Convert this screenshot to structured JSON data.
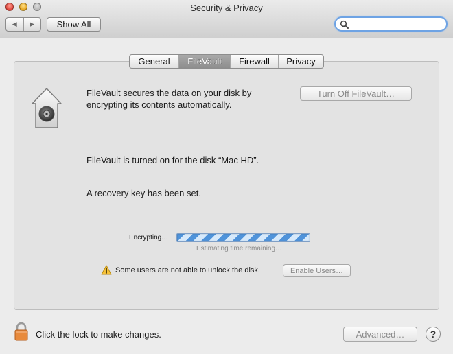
{
  "window": {
    "title": "Security & Privacy"
  },
  "toolbar": {
    "back_icon": "back-triangle-icon",
    "forward_icon": "forward-triangle-icon",
    "show_all_label": "Show All",
    "search_value": "",
    "search_placeholder": ""
  },
  "tabs": [
    {
      "label": "General",
      "active": false
    },
    {
      "label": "FileVault",
      "active": true
    },
    {
      "label": "Firewall",
      "active": false
    },
    {
      "label": "Privacy",
      "active": false
    }
  ],
  "filevault": {
    "icon": "filevault-house-icon",
    "intro": "FileVault secures the data on your disk by encrypting its contents automatically.",
    "turn_off_label": "Turn Off FileVault…",
    "status_on": "FileVault is turned on for the disk “Mac HD”.",
    "recovery_status": "A recovery key has been set.",
    "encrypting_label": "Encrypting…",
    "progress_percent": 100,
    "estimate_text": "Estimating time remaining…",
    "warning_text": "Some users are not able to unlock the disk.",
    "enable_users_label": "Enable Users…"
  },
  "footer": {
    "lock_text": "Click the lock to make changes.",
    "advanced_label": "Advanced…",
    "help_label": "?"
  },
  "colors": {
    "progress_blue": "#4f93da",
    "search_focus": "#6ea3e4",
    "active_tab": "#9a9a9a",
    "lock_orange": "#e88a3c"
  }
}
